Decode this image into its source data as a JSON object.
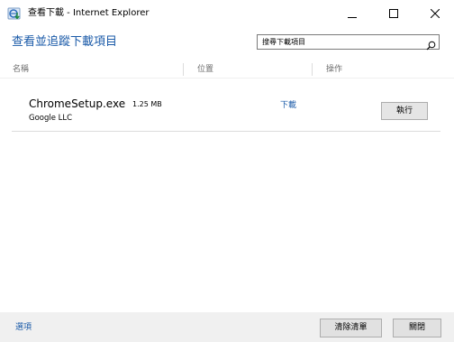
{
  "window": {
    "title": "查看下載 - Internet Explorer",
    "controls": [
      "minimize",
      "maximize",
      "close"
    ]
  },
  "header": {
    "heading": "查看並追蹤下載項目",
    "search_text": "搜尋下載項目",
    "search_icon": "search-icon"
  },
  "columns": [
    "名稱",
    "位置",
    "操作"
  ],
  "downloads": [
    {
      "name": "ChromeSetup.exe",
      "size": "1.25 MB",
      "publisher": "Google LLC",
      "location": "下載",
      "action": "執行"
    }
  ],
  "footer": {
    "options": "選項",
    "clear_list": "清除清單",
    "close": "關閉"
  },
  "colors": {
    "link_blue": "#1a5aa8",
    "footer_bg": "#f0f0f0",
    "button_bg": "#e1e1e1"
  }
}
